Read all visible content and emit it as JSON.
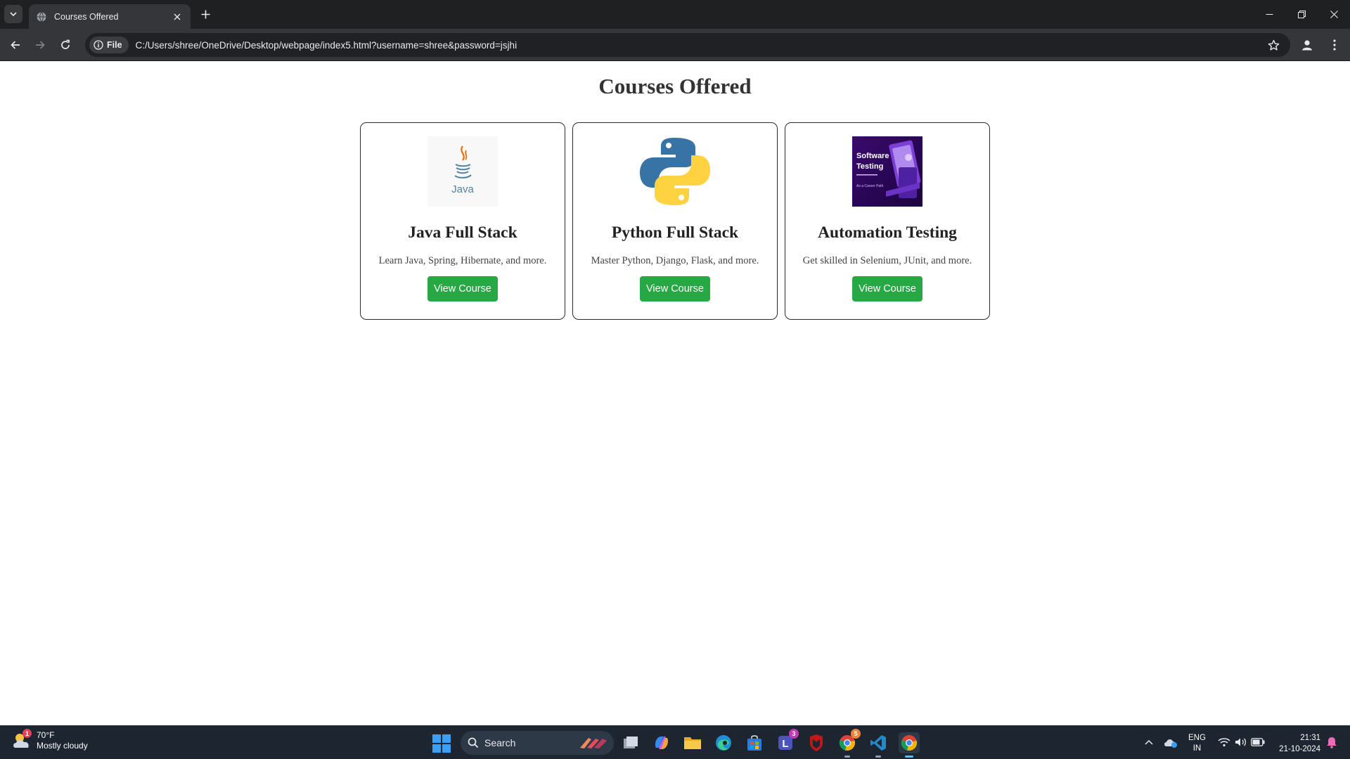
{
  "browser": {
    "tab_title": "Courses Offered",
    "security_chip": "File",
    "url": "C:/Users/shree/OneDrive/Desktop/webpage/index5.html?username=shree&password=jsjhi"
  },
  "page": {
    "heading": "Courses Offered",
    "courses": [
      {
        "title": "Java Full Stack",
        "description": "Learn Java, Spring, Hibernate, and more.",
        "button": "View Course",
        "image": "java-logo",
        "image_text": "Java"
      },
      {
        "title": "Python Full Stack",
        "description": "Master Python, Django, Flask, and more.",
        "button": "View Course",
        "image": "python-logo"
      },
      {
        "title": "Automation Testing",
        "description": "Get skilled in Selenium, JUnit, and more.",
        "button": "View Course",
        "image": "software-testing-banner",
        "image_text_1": "Software",
        "image_text_2": "Testing",
        "image_text_3": "As a Career Path"
      }
    ],
    "colors": {
      "button": "#28a745",
      "card_border": "#2b2b2b",
      "heading": "#333333"
    }
  },
  "taskbar": {
    "weather_temp": "70°F",
    "weather_desc": "Mostly cloudy",
    "weather_badge": "1",
    "search_label": "Search",
    "teams_badge": "3",
    "chrome_badge": "5",
    "lang_line1": "ENG",
    "lang_line2": "IN",
    "time": "21:31",
    "date": "21-10-2024"
  }
}
